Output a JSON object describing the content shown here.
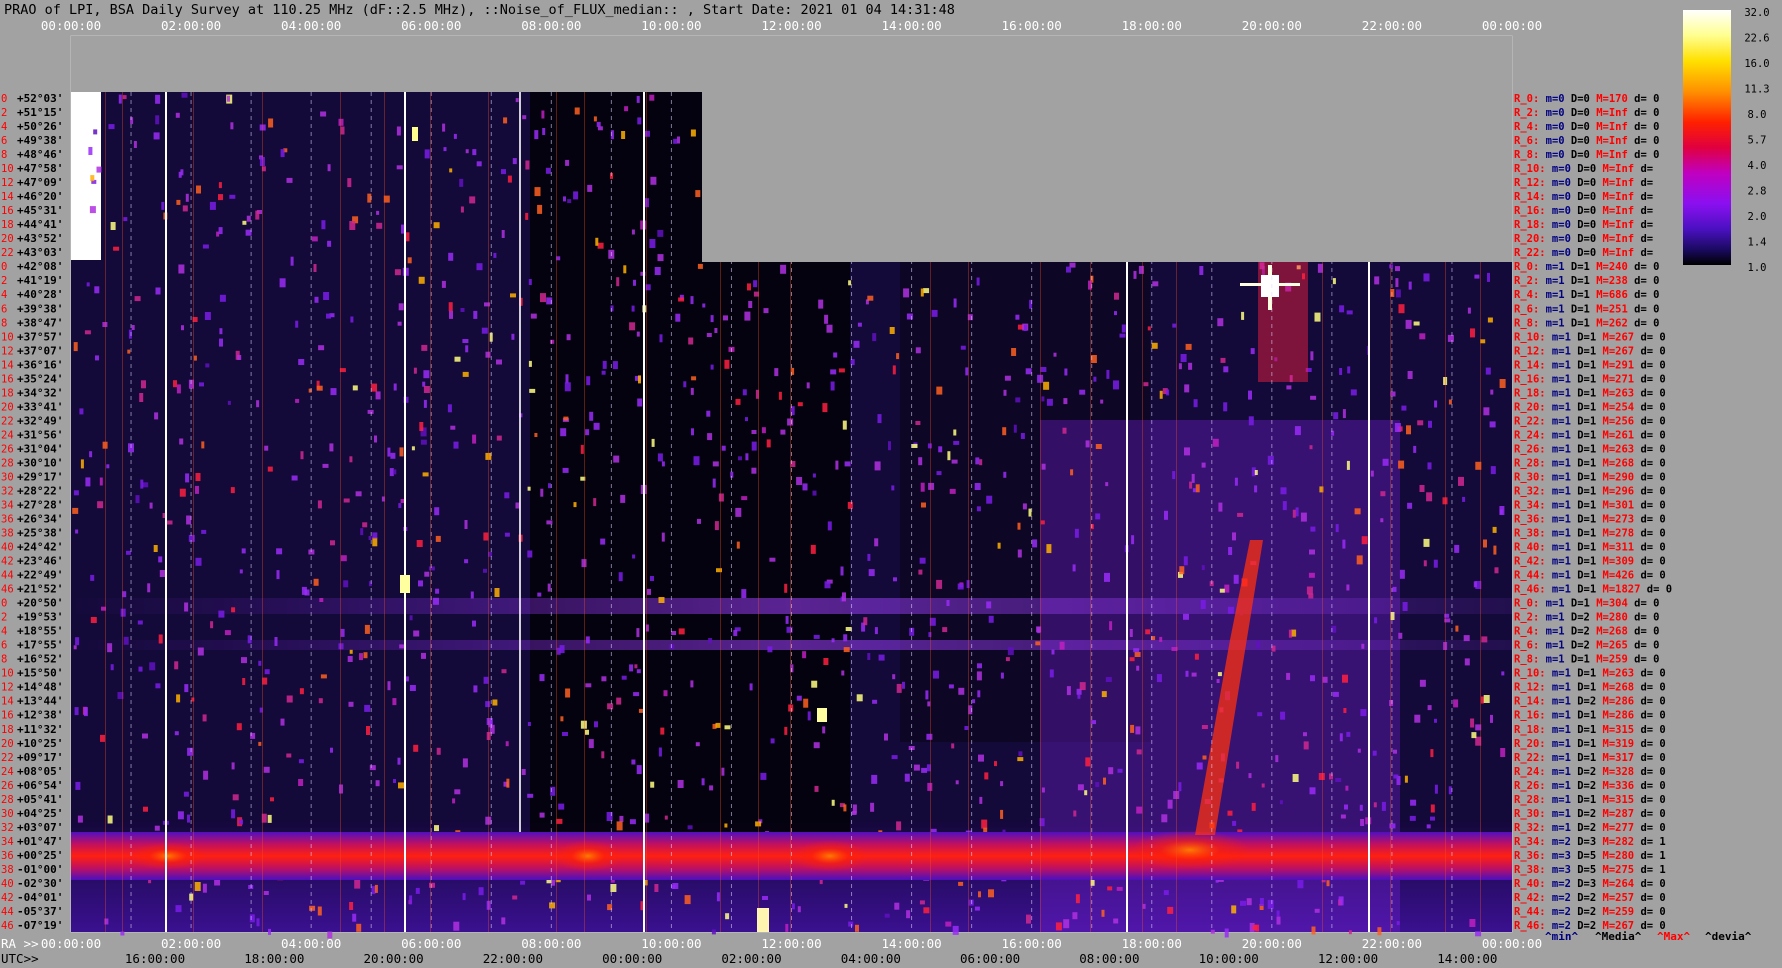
{
  "title": "PRAO of LPI, BSA Daily Survey at 110.25 MHz (dF::2.5 MHz), ::Noise_of_FLUX_median:: , Start Date: 2021 01 04 14:31:48",
  "colors": {
    "background": "#a2a2a2",
    "index_label": "#ff0000",
    "dec_label": "#000000",
    "stat_red": "#ff0000",
    "stat_blue": "#000080"
  },
  "chart_data": {
    "type": "heatmap",
    "top_axis": {
      "labels": [
        "00:00:00",
        "02:00:00",
        "04:00:00",
        "06:00:00",
        "08:00:00",
        "10:00:00",
        "12:00:00",
        "14:00:00",
        "16:00:00",
        "18:00:00",
        "20:00:00",
        "22:00:00",
        "00:00:00"
      ]
    },
    "bottom_axis": {
      "ra_prefix": "RA >>",
      "ra_labels": [
        "00:00:00",
        "02:00:00",
        "04:00:00",
        "06:00:00",
        "08:00:00",
        "10:00:00",
        "12:00:00",
        "14:00:00",
        "16:00:00",
        "18:00:00",
        "20:00:00",
        "22:00:00",
        "00:00:00"
      ],
      "utc_prefix": "UTC>>",
      "utc_labels": [
        "16:00:00",
        "18:00:00",
        "20:00:00",
        "22:00:00",
        "00:00:00",
        "02:00:00",
        "04:00:00",
        "06:00:00",
        "08:00:00",
        "10:00:00",
        "12:00:00",
        "14:00:00"
      ]
    },
    "bottom_legend": [
      "^min^",
      "^Media^",
      "^Max^",
      "^devia^"
    ],
    "colorbar": {
      "ticks": [
        "32.0",
        "22.6",
        "16.0",
        "11.3",
        "8.0",
        "5.7",
        "4.0",
        "2.8",
        "2.0",
        "1.4",
        "1.0"
      ]
    },
    "declination_rows": [
      {
        "i": "0",
        "dec": "+52°03'"
      },
      {
        "i": "2",
        "dec": "+51°15'"
      },
      {
        "i": "4",
        "dec": "+50°26'"
      },
      {
        "i": "6",
        "dec": "+49°38'"
      },
      {
        "i": "8",
        "dec": "+48°46'"
      },
      {
        "i": "10",
        "dec": "+47°58'"
      },
      {
        "i": "12",
        "dec": "+47°09'"
      },
      {
        "i": "14",
        "dec": "+46°20'"
      },
      {
        "i": "16",
        "dec": "+45°31'"
      },
      {
        "i": "18",
        "dec": "+44°41'"
      },
      {
        "i": "20",
        "dec": "+43°52'"
      },
      {
        "i": "22",
        "dec": "+43°03'"
      },
      {
        "i": "0",
        "dec": "+42°08'"
      },
      {
        "i": "2",
        "dec": "+41°19'"
      },
      {
        "i": "4",
        "dec": "+40°28'"
      },
      {
        "i": "6",
        "dec": "+39°38'"
      },
      {
        "i": "8",
        "dec": "+38°47'"
      },
      {
        "i": "10",
        "dec": "+37°57'"
      },
      {
        "i": "12",
        "dec": "+37°07'"
      },
      {
        "i": "14",
        "dec": "+36°16'"
      },
      {
        "i": "16",
        "dec": "+35°24'"
      },
      {
        "i": "18",
        "dec": "+34°32'"
      },
      {
        "i": "20",
        "dec": "+33°41'"
      },
      {
        "i": "22",
        "dec": "+32°49'"
      },
      {
        "i": "24",
        "dec": "+31°56'"
      },
      {
        "i": "26",
        "dec": "+31°04'"
      },
      {
        "i": "28",
        "dec": "+30°10'"
      },
      {
        "i": "30",
        "dec": "+29°17'"
      },
      {
        "i": "32",
        "dec": "+28°22'"
      },
      {
        "i": "34",
        "dec": "+27°28'"
      },
      {
        "i": "36",
        "dec": "+26°34'"
      },
      {
        "i": "38",
        "dec": "+25°38'"
      },
      {
        "i": "40",
        "dec": "+24°42'"
      },
      {
        "i": "42",
        "dec": "+23°46'"
      },
      {
        "i": "44",
        "dec": "+22°49'"
      },
      {
        "i": "46",
        "dec": "+21°52'"
      },
      {
        "i": "0",
        "dec": "+20°50'"
      },
      {
        "i": "2",
        "dec": "+19°53'"
      },
      {
        "i": "4",
        "dec": "+18°55'"
      },
      {
        "i": "6",
        "dec": "+17°55'"
      },
      {
        "i": "8",
        "dec": "+16°52'"
      },
      {
        "i": "10",
        "dec": "+15°50'"
      },
      {
        "i": "12",
        "dec": "+14°48'"
      },
      {
        "i": "14",
        "dec": "+13°44'"
      },
      {
        "i": "16",
        "dec": "+12°38'"
      },
      {
        "i": "18",
        "dec": "+11°32'"
      },
      {
        "i": "20",
        "dec": "+10°25'"
      },
      {
        "i": "22",
        "dec": "+09°17'"
      },
      {
        "i": "24",
        "dec": "+08°05'"
      },
      {
        "i": "26",
        "dec": "+06°54'"
      },
      {
        "i": "28",
        "dec": "+05°41'"
      },
      {
        "i": "30",
        "dec": "+04°25'"
      },
      {
        "i": "32",
        "dec": "+03°07'"
      },
      {
        "i": "34",
        "dec": "+01°47'"
      },
      {
        "i": "36",
        "dec": "+00°25'"
      },
      {
        "i": "38",
        "dec": "-01°00'"
      },
      {
        "i": "40",
        "dec": "-02°30'"
      },
      {
        "i": "42",
        "dec": "-04°01'"
      },
      {
        "i": "44",
        "dec": "-05°37'"
      },
      {
        "i": "46",
        "dec": "-07°19'"
      }
    ],
    "row_stats": [
      {
        "r": "R_0:",
        "m": "m=0",
        "D": "D=0",
        "M": "M=170",
        "d": "d= 0"
      },
      {
        "r": "R_2:",
        "m": "m=0",
        "D": "D=0",
        "M": "M=Inf",
        "d": "d= 0"
      },
      {
        "r": "R_4:",
        "m": "m=0",
        "D": "D=0",
        "M": "M=Inf",
        "d": "d= 0"
      },
      {
        "r": "R_6:",
        "m": "m=0",
        "D": "D=0",
        "M": "M=Inf",
        "d": "d= 0"
      },
      {
        "r": "R_8:",
        "m": "m=0",
        "D": "D=0",
        "M": "M=Inf",
        "d": "d= 0"
      },
      {
        "r": "R_10:",
        "m": "m=0",
        "D": "D=0",
        "M": "M=Inf",
        "d": "d="
      },
      {
        "r": "R_12:",
        "m": "m=0",
        "D": "D=0",
        "M": "M=Inf",
        "d": "d="
      },
      {
        "r": "R_14:",
        "m": "m=0",
        "D": "D=0",
        "M": "M=Inf",
        "d": "d="
      },
      {
        "r": "R_16:",
        "m": "m=0",
        "D": "D=0",
        "M": "M=Inf",
        "d": "d="
      },
      {
        "r": "R_18:",
        "m": "m=0",
        "D": "D=0",
        "M": "M=Inf",
        "d": "d="
      },
      {
        "r": "R_20:",
        "m": "m=0",
        "D": "D=0",
        "M": "M=Inf",
        "d": "d="
      },
      {
        "r": "R_22:",
        "m": "m=0",
        "D": "D=0",
        "M": "M=Inf",
        "d": "d="
      },
      {
        "r": "R_0:",
        "m": "m=1",
        "D": "D=1",
        "M": "M=240",
        "d": "d= 0"
      },
      {
        "r": "R_2:",
        "m": "m=1",
        "D": "D=1",
        "M": "M=238",
        "d": "d= 0"
      },
      {
        "r": "R_4:",
        "m": "m=1",
        "D": "D=1",
        "M": "M=686",
        "d": "d= 0"
      },
      {
        "r": "R_6:",
        "m": "m=1",
        "D": "D=1",
        "M": "M=251",
        "d": "d= 0"
      },
      {
        "r": "R_8:",
        "m": "m=1",
        "D": "D=1",
        "M": "M=262",
        "d": "d= 0"
      },
      {
        "r": "R_10:",
        "m": "m=1",
        "D": "D=1",
        "M": "M=267",
        "d": "d= 0"
      },
      {
        "r": "R_12:",
        "m": "m=1",
        "D": "D=1",
        "M": "M=267",
        "d": "d= 0"
      },
      {
        "r": "R_14:",
        "m": "m=1",
        "D": "D=1",
        "M": "M=291",
        "d": "d= 0"
      },
      {
        "r": "R_16:",
        "m": "m=1",
        "D": "D=1",
        "M": "M=271",
        "d": "d= 0"
      },
      {
        "r": "R_18:",
        "m": "m=1",
        "D": "D=1",
        "M": "M=263",
        "d": "d= 0"
      },
      {
        "r": "R_20:",
        "m": "m=1",
        "D": "D=1",
        "M": "M=254",
        "d": "d= 0"
      },
      {
        "r": "R_22:",
        "m": "m=1",
        "D": "D=1",
        "M": "M=256",
        "d": "d= 0"
      },
      {
        "r": "R_24:",
        "m": "m=1",
        "D": "D=1",
        "M": "M=261",
        "d": "d= 0"
      },
      {
        "r": "R_26:",
        "m": "m=1",
        "D": "D=1",
        "M": "M=263",
        "d": "d= 0"
      },
      {
        "r": "R_28:",
        "m": "m=1",
        "D": "D=1",
        "M": "M=268",
        "d": "d= 0"
      },
      {
        "r": "R_30:",
        "m": "m=1",
        "D": "D=1",
        "M": "M=290",
        "d": "d= 0"
      },
      {
        "r": "R_32:",
        "m": "m=1",
        "D": "D=1",
        "M": "M=296",
        "d": "d= 0"
      },
      {
        "r": "R_34:",
        "m": "m=1",
        "D": "D=1",
        "M": "M=301",
        "d": "d= 0"
      },
      {
        "r": "R_36:",
        "m": "m=1",
        "D": "D=1",
        "M": "M=273",
        "d": "d= 0"
      },
      {
        "r": "R_38:",
        "m": "m=1",
        "D": "D=1",
        "M": "M=278",
        "d": "d= 0"
      },
      {
        "r": "R_40:",
        "m": "m=1",
        "D": "D=1",
        "M": "M=311",
        "d": "d= 0"
      },
      {
        "r": "R_42:",
        "m": "m=1",
        "D": "D=1",
        "M": "M=309",
        "d": "d= 0"
      },
      {
        "r": "R_44:",
        "m": "m=1",
        "D": "D=1",
        "M": "M=426",
        "d": "d= 0"
      },
      {
        "r": "R_46:",
        "m": "m=1",
        "D": "D=1",
        "M": "M=1827",
        "d": "d= 0"
      },
      {
        "r": "R_0:",
        "m": "m=1",
        "D": "D=1",
        "M": "M=304",
        "d": "d= 0"
      },
      {
        "r": "R_2:",
        "m": "m=1",
        "D": "D=2",
        "M": "M=280",
        "d": "d= 0"
      },
      {
        "r": "R_4:",
        "m": "m=1",
        "D": "D=2",
        "M": "M=268",
        "d": "d= 0"
      },
      {
        "r": "R_6:",
        "m": "m=1",
        "D": "D=2",
        "M": "M=265",
        "d": "d= 0"
      },
      {
        "r": "R_8:",
        "m": "m=1",
        "D": "D=1",
        "M": "M=259",
        "d": "d= 0"
      },
      {
        "r": "R_10:",
        "m": "m=1",
        "D": "D=1",
        "M": "M=263",
        "d": "d= 0"
      },
      {
        "r": "R_12:",
        "m": "m=1",
        "D": "D=1",
        "M": "M=268",
        "d": "d= 0"
      },
      {
        "r": "R_14:",
        "m": "m=1",
        "D": "D=2",
        "M": "M=286",
        "d": "d= 0"
      },
      {
        "r": "R_16:",
        "m": "m=1",
        "D": "D=1",
        "M": "M=286",
        "d": "d= 0"
      },
      {
        "r": "R_18:",
        "m": "m=1",
        "D": "D=1",
        "M": "M=315",
        "d": "d= 0"
      },
      {
        "r": "R_20:",
        "m": "m=1",
        "D": "D=1",
        "M": "M=319",
        "d": "d= 0"
      },
      {
        "r": "R_22:",
        "m": "m=1",
        "D": "D=1",
        "M": "M=317",
        "d": "d= 0"
      },
      {
        "r": "R_24:",
        "m": "m=1",
        "D": "D=2",
        "M": "M=328",
        "d": "d= 0"
      },
      {
        "r": "R_26:",
        "m": "m=1",
        "D": "D=2",
        "M": "M=336",
        "d": "d= 0"
      },
      {
        "r": "R_28:",
        "m": "m=1",
        "D": "D=1",
        "M": "M=315",
        "d": "d= 0"
      },
      {
        "r": "R_30:",
        "m": "m=1",
        "D": "D=2",
        "M": "M=287",
        "d": "d= 0"
      },
      {
        "r": "R_32:",
        "m": "m=1",
        "D": "D=2",
        "M": "M=277",
        "d": "d= 0"
      },
      {
        "r": "R_34:",
        "m": "m=2",
        "D": "D=3",
        "M": "M=282",
        "d": "d= 1"
      },
      {
        "r": "R_36:",
        "m": "m=3",
        "D": "D=5",
        "M": "M=280",
        "d": "d= 1"
      },
      {
        "r": "R_38:",
        "m": "m=3",
        "D": "D=5",
        "M": "M=275",
        "d": "d= 1"
      },
      {
        "r": "R_40:",
        "m": "m=2",
        "D": "D=3",
        "M": "M=264",
        "d": "d= 0"
      },
      {
        "r": "R_42:",
        "m": "m=2",
        "D": "D=2",
        "M": "M=257",
        "d": "d= 0"
      },
      {
        "r": "R_44:",
        "m": "m=2",
        "D": "D=2",
        "M": "M=259",
        "d": "d= 0"
      },
      {
        "r": "R_46:",
        "m": "m=2",
        "D": "D=2",
        "M": "M=267",
        "d": "d= 0"
      }
    ]
  }
}
